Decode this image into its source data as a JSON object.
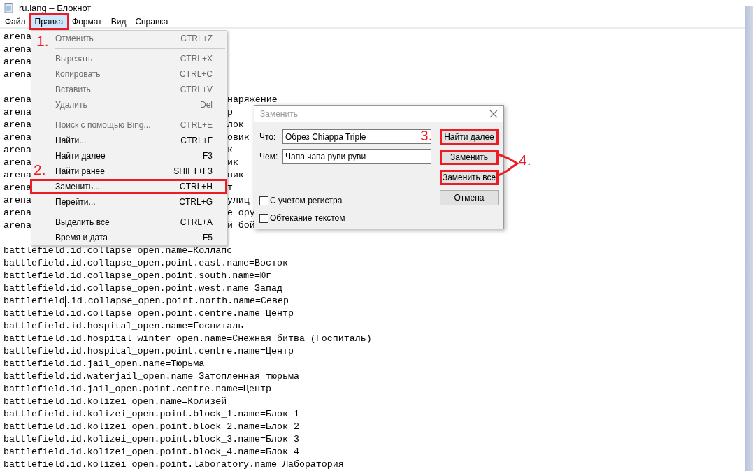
{
  "window": {
    "title": "ru.lang – Блокнот"
  },
  "menu_bar": [
    {
      "label": "Файл",
      "selected": false,
      "annotated": false
    },
    {
      "label": "Правка",
      "selected": true,
      "annotated": true
    },
    {
      "label": "Формат",
      "selected": false,
      "annotated": false
    },
    {
      "label": "Вид",
      "selected": false,
      "annotated": false
    },
    {
      "label": "Справка",
      "selected": false,
      "annotated": false
    }
  ],
  "edit_menu": {
    "items": [
      {
        "kind": "item",
        "label": "Отменить",
        "shortcut": "CTRL+Z",
        "disabled": true,
        "annotated": false
      },
      {
        "kind": "separator"
      },
      {
        "kind": "item",
        "label": "Вырезать",
        "shortcut": "CTRL+X",
        "disabled": true,
        "annotated": false
      },
      {
        "kind": "item",
        "label": "Копировать",
        "shortcut": "CTRL+C",
        "disabled": true,
        "annotated": false
      },
      {
        "kind": "item",
        "label": "Вставить",
        "shortcut": "CTRL+V",
        "disabled": true,
        "annotated": false
      },
      {
        "kind": "item",
        "label": "Удалить",
        "shortcut": "Del",
        "disabled": true,
        "annotated": false
      },
      {
        "kind": "separator"
      },
      {
        "kind": "item",
        "label": "Поиск с помощью Bing...",
        "shortcut": "CTRL+E",
        "disabled": true,
        "annotated": false
      },
      {
        "kind": "item",
        "label": "Найти...",
        "shortcut": "CTRL+F",
        "disabled": false,
        "annotated": false
      },
      {
        "kind": "item",
        "label": "Найти далее",
        "shortcut": "F3",
        "disabled": false,
        "annotated": false
      },
      {
        "kind": "item",
        "label": "Найти ранее",
        "shortcut": "SHIFT+F3",
        "disabled": false,
        "annotated": false
      },
      {
        "kind": "item",
        "label": "Заменить...",
        "shortcut": "CTRL+H",
        "disabled": false,
        "annotated": true
      },
      {
        "kind": "item",
        "label": "Перейти...",
        "shortcut": "CTRL+G",
        "disabled": false,
        "annotated": false
      },
      {
        "kind": "separator"
      },
      {
        "kind": "item",
        "label": "Выделить все",
        "shortcut": "CTRL+A",
        "disabled": false,
        "annotated": false
      },
      {
        "kind": "item",
        "label": "Время и дата",
        "shortcut": "F5",
        "disabled": false,
        "annotated": false
      }
    ]
  },
  "editor": {
    "lines": [
      {
        "kind": "covered",
        "start": "arena"
      },
      {
        "kind": "covered",
        "start": "arena"
      },
      {
        "kind": "covered",
        "start": "arena"
      },
      {
        "kind": "covered",
        "start": "arena"
      },
      {
        "kind": "blank"
      },
      {
        "kind": "covered",
        "start": "arena",
        "end": "наряжение"
      },
      {
        "kind": "covered",
        "start": "arena",
        "end": "р"
      },
      {
        "kind": "covered",
        "start": "arena",
        "end": "лок"
      },
      {
        "kind": "covered",
        "start": "arena",
        "end": "овик"
      },
      {
        "kind": "covered",
        "start": "arena",
        "end": "к"
      },
      {
        "kind": "covered",
        "start": "arena",
        "end": "ик"
      },
      {
        "kind": "covered",
        "start": "arena",
        "end": "ник"
      },
      {
        "kind": "covered",
        "start": "arena",
        "end": "т"
      },
      {
        "kind": "covered",
        "start": "arena",
        "end": "улиц"
      },
      {
        "kind": "covered",
        "start": "arena",
        "end": "е ору"
      },
      {
        "kind": "covered",
        "start": "arena",
        "end": "й бой"
      },
      {
        "kind": "blank"
      },
      {
        "kind": "full",
        "text": "battlefield.id.collapse_open.name=Коллапс"
      },
      {
        "kind": "full",
        "text": "battlefield.id.collapse_open.point.east.name=Восток"
      },
      {
        "kind": "full",
        "text": "battlefield.id.collapse_open.point.south.name=Юг"
      },
      {
        "kind": "full",
        "text": "battlefield.id.collapse_open.point.west.name=Запад"
      },
      {
        "kind": "caret",
        "before": "battlefield",
        "after": ".id.collapse_open.point.north.name=Север"
      },
      {
        "kind": "full",
        "text": "battlefield.id.collapse_open.point.centre.name=Центр"
      },
      {
        "kind": "full",
        "text": "battlefield.id.hospital_open.name=Госпиталь"
      },
      {
        "kind": "full",
        "text": "battlefield.id.hospital_winter_open.name=Снежная битва (Госпиталь)"
      },
      {
        "kind": "full",
        "text": "battlefield.id.hospital_open.point.centre.name=Центр"
      },
      {
        "kind": "full",
        "text": "battlefield.id.jail_open.name=Тюрьма"
      },
      {
        "kind": "full",
        "text": "battlefield.id.waterjail_open.name=Затопленная тюрьма"
      },
      {
        "kind": "full",
        "text": "battlefield.id.jail_open.point.centre.name=Центр"
      },
      {
        "kind": "full",
        "text": "battlefield.id.kolizei_open.name=Колизей"
      },
      {
        "kind": "full",
        "text": "battlefield.id.kolizei_open.point.block_1.name=Блок 1"
      },
      {
        "kind": "full",
        "text": "battlefield.id.kolizei_open.point.block_2.name=Блок 2"
      },
      {
        "kind": "full",
        "text": "battlefield.id.kolizei_open.point.block_3.name=Блок 3"
      },
      {
        "kind": "full",
        "text": "battlefield.id.kolizei_open.point.block_4.name=Блок 4"
      },
      {
        "kind": "full",
        "text": "battlefield.id.kolizei_open.point.laboratory.name=Лаборатория"
      }
    ]
  },
  "replace_dialog": {
    "title": "Заменить",
    "fields": [
      {
        "label": "Что:",
        "value": "Обрез Chiappa Triple"
      },
      {
        "label": "Чем:",
        "value": "Чапа чапа руви руви"
      }
    ],
    "buttons": [
      {
        "label": "Найти далее",
        "annotated": true
      },
      {
        "label": "Заменить",
        "annotated": true
      },
      {
        "label": "Заменить все",
        "annotated": true
      },
      {
        "label": "Отмена",
        "annotated": false
      }
    ],
    "options": [
      {
        "label": "С учетом регистра",
        "checked": false
      },
      {
        "label": "Обтекание текстом",
        "checked": false
      }
    ]
  },
  "annotations": [
    {
      "label": "1."
    },
    {
      "label": "2."
    },
    {
      "label": "3."
    },
    {
      "label": "4."
    }
  ]
}
